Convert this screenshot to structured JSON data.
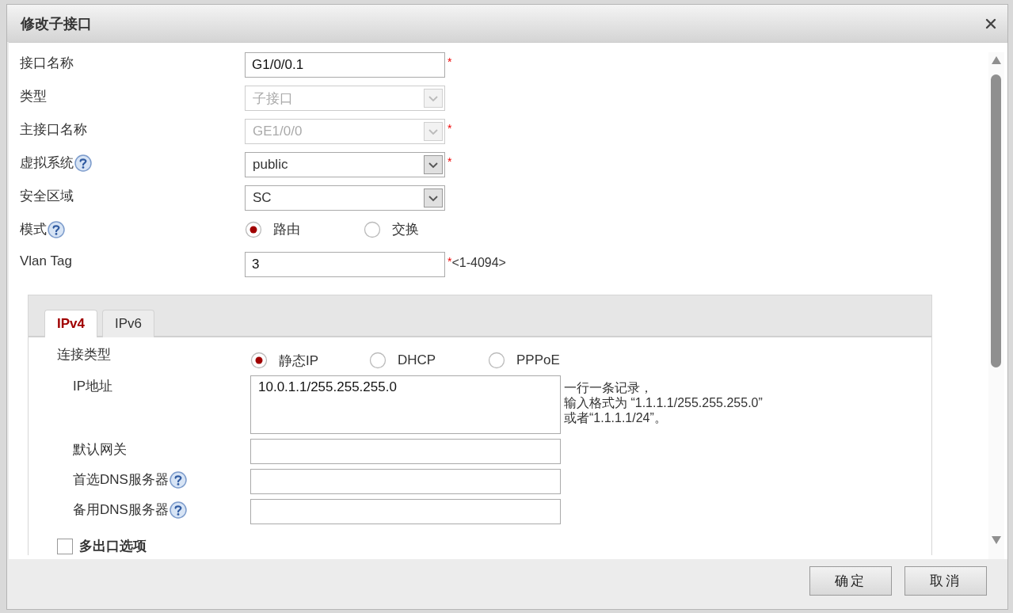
{
  "dialog": {
    "title": "修改子接口",
    "fields": [
      {
        "kind": "text",
        "label": "接口名称",
        "value": "G1/0/0.1",
        "required_mark": "*"
      },
      {
        "kind": "select",
        "label": "类型",
        "value": "子接口",
        "disabled": true
      },
      {
        "kind": "select",
        "label": "主接口名称",
        "value": "GE1/0/0",
        "disabled": true,
        "required_mark": "*"
      },
      {
        "kind": "select",
        "label": "虚拟系统",
        "help": true,
        "value": "public",
        "disabled": false,
        "required_mark": "*"
      },
      {
        "kind": "select",
        "label": "安全区域",
        "value": "SC",
        "disabled": false
      },
      {
        "kind": "radio",
        "label": "模式",
        "help": true,
        "options": [
          {
            "label": "路由",
            "selected": true
          },
          {
            "label": "交换",
            "selected": false
          }
        ]
      },
      {
        "kind": "text",
        "label": "Vlan Tag",
        "value": "3",
        "required_mark": "*",
        "hint": "<1-4094>"
      }
    ],
    "tabs": [
      {
        "label": "IPv4",
        "selected": true
      },
      {
        "label": "IPv6",
        "selected": false
      }
    ],
    "ipv4": {
      "connection": {
        "label": "连接类型",
        "options": [
          {
            "label": "静态IP",
            "selected": true
          },
          {
            "label": "DHCP",
            "selected": false
          },
          {
            "label": "PPPoE",
            "selected": false
          }
        ]
      },
      "fields": [
        {
          "kind": "textarea",
          "label": "IP地址",
          "value": "10.0.1.1/255.255.255.0",
          "note": [
            "一行一条记录，",
            "输入格式为 “1.1.1.1/255.255.255.0”",
            "或者“1.1.1.1/24”。"
          ]
        },
        {
          "kind": "text",
          "label": "默认网关"
        },
        {
          "kind": "text",
          "label": "首选DNS服务器",
          "help": true
        },
        {
          "kind": "text",
          "label": "备用DNS服务器",
          "help": true
        }
      ],
      "multi_exit": {
        "label": "多出口选项",
        "checked": false
      }
    },
    "buttons": [
      "确定",
      "取消"
    ]
  }
}
